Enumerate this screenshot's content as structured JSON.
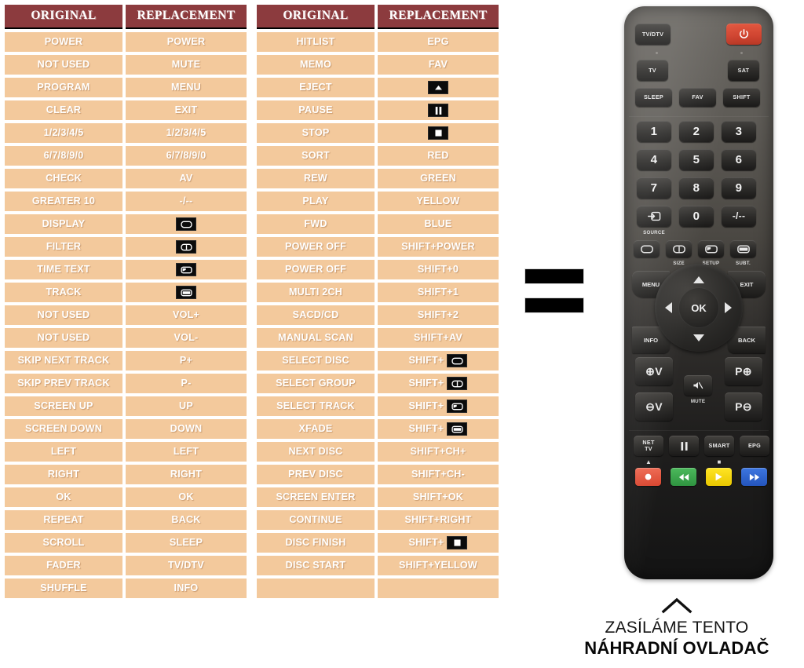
{
  "tables": {
    "headers": {
      "original": "ORIGINAL",
      "replacement": "REPLACEMENT"
    },
    "left": [
      {
        "original": "POWER",
        "replacement": "POWER"
      },
      {
        "original": "NOT USED",
        "replacement": "MUTE"
      },
      {
        "original": "PROGRAM",
        "replacement": "MENU"
      },
      {
        "original": "CLEAR",
        "replacement": "EXIT"
      },
      {
        "original": "1/2/3/4/5",
        "replacement": "1/2/3/4/5"
      },
      {
        "original": "6/7/8/9/0",
        "replacement": "6/7/8/9/0"
      },
      {
        "original": "CHECK",
        "replacement": "AV"
      },
      {
        "original": "GREATER 10",
        "replacement": "-/--"
      },
      {
        "original": "DISPLAY",
        "replacement": "",
        "icon": "display-icon"
      },
      {
        "original": "FILTER",
        "replacement": "",
        "icon": "size-icon"
      },
      {
        "original": "TIME TEXT",
        "replacement": "",
        "icon": "setup-icon"
      },
      {
        "original": "TRACK",
        "replacement": "",
        "icon": "subtitle-icon"
      },
      {
        "original": "NOT USED",
        "replacement": "VOL+"
      },
      {
        "original": "NOT USED",
        "replacement": "VOL-"
      },
      {
        "original": "SKIP NEXT TRACK",
        "replacement": "P+"
      },
      {
        "original": "SKIP PREV TRACK",
        "replacement": "P-"
      },
      {
        "original": "SCREEN UP",
        "replacement": "UP"
      },
      {
        "original": "SCREEN DOWN",
        "replacement": "DOWN"
      },
      {
        "original": "LEFT",
        "replacement": "LEFT"
      },
      {
        "original": "RIGHT",
        "replacement": "RIGHT"
      },
      {
        "original": "OK",
        "replacement": "OK"
      },
      {
        "original": "REPEAT",
        "replacement": "BACK"
      },
      {
        "original": "SCROLL",
        "replacement": "SLEEP"
      },
      {
        "original": "FADER",
        "replacement": "TV/DTV"
      },
      {
        "original": "SHUFFLE",
        "replacement": "INFO"
      }
    ],
    "right": [
      {
        "original": "HITLIST",
        "replacement": "EPG"
      },
      {
        "original": "MEMO",
        "replacement": "FAV"
      },
      {
        "original": "EJECT",
        "replacement": "",
        "icon": "eject-icon"
      },
      {
        "original": "PAUSE",
        "replacement": "",
        "icon": "pause-icon"
      },
      {
        "original": "STOP",
        "replacement": "",
        "icon": "stop-icon"
      },
      {
        "original": "SORT",
        "replacement": "RED"
      },
      {
        "original": "REW",
        "replacement": "GREEN"
      },
      {
        "original": "PLAY",
        "replacement": "YELLOW"
      },
      {
        "original": "FWD",
        "replacement": "BLUE"
      },
      {
        "original": "POWER OFF",
        "replacement": "SHIFT+POWER"
      },
      {
        "original": "POWER OFF",
        "replacement": "SHIFT+0"
      },
      {
        "original": "MULTI 2CH",
        "replacement": "SHIFT+1"
      },
      {
        "original": "SACD/CD",
        "replacement": "SHIFT+2"
      },
      {
        "original": "MANUAL SCAN",
        "replacement": "SHIFT+AV"
      },
      {
        "original": "SELECT DISC",
        "replacement": "SHIFT+",
        "icon": "display-icon"
      },
      {
        "original": "SELECT GROUP",
        "replacement": "SHIFT+",
        "icon": "size-icon"
      },
      {
        "original": "SELECT TRACK",
        "replacement": "SHIFT+",
        "icon": "setup-icon"
      },
      {
        "original": "XFADE",
        "replacement": "SHIFT+",
        "icon": "subtitle-icon"
      },
      {
        "original": "NEXT DISC",
        "replacement": "SHIFT+CH+"
      },
      {
        "original": "PREV DISC",
        "replacement": "SHIFT+CH-"
      },
      {
        "original": "SCREEN ENTER",
        "replacement": "SHIFT+OK"
      },
      {
        "original": "CONTINUE",
        "replacement": "SHIFT+RIGHT"
      },
      {
        "original": "DISC FINISH",
        "replacement": "SHIFT+",
        "icon": "stop-icon"
      },
      {
        "original": "DISC START",
        "replacement": "SHIFT+YELLOW"
      },
      {
        "original": "",
        "replacement": ""
      }
    ]
  },
  "equals": {
    "name": "equals-sign"
  },
  "remote": {
    "buttons": {
      "tvdtv": "TV/DTV",
      "power": "",
      "tv": "TV",
      "sat": "SAT",
      "sleep": "SLEEP",
      "fav": "FAV",
      "shift": "SHIFT",
      "n1": "1",
      "n2": "2",
      "n3": "3",
      "n4": "4",
      "n5": "5",
      "n6": "6",
      "n7": "7",
      "n8": "8",
      "n9": "9",
      "source": "",
      "n0": "0",
      "dash": "-/--",
      "menu": "MENU",
      "exit": "EXIT",
      "info": "INFO",
      "back": "BACK",
      "ok": "OK",
      "volup": "V",
      "voldown": "V",
      "mute": "MUTE",
      "pup": "P",
      "pdown": "P",
      "nettv_line1": "NET",
      "nettv_line2": "TV",
      "pause": "",
      "smart": "SMART",
      "epg": "EPG"
    },
    "labels": {
      "source": "SOURCE",
      "size": "SIZE",
      "setup": "SETUP",
      "subtitle": "SUBT."
    },
    "colors": {
      "power": "#d6472f",
      "record": "#e8533f",
      "rewind": "#37a349",
      "play": "#f2d400",
      "forward": "#2f63cf",
      "body": "#3a3836"
    }
  },
  "caption": {
    "line1": "ZASÍLÁME TENTO",
    "line2": "NÁHRADNÍ OVLADAČ"
  }
}
